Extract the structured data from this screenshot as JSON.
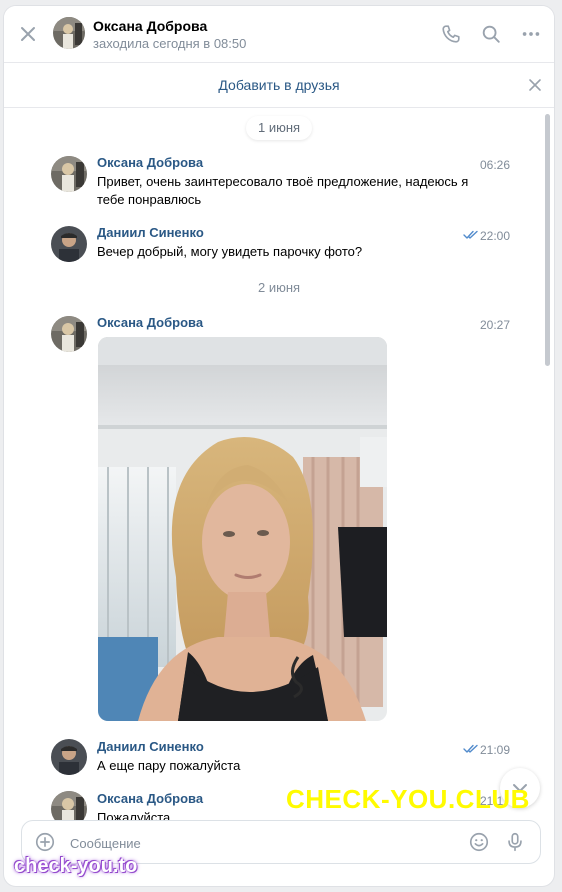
{
  "header": {
    "contact_name": "Оксана Доброва",
    "status": "заходила сегодня в 08:50",
    "icons": [
      "close-icon",
      "phone-icon",
      "search-icon",
      "more-icon"
    ]
  },
  "friend_bar": {
    "label": "Добавить в друзья"
  },
  "messages": [
    {
      "date": "1 июня"
    },
    {
      "author": "Оксана Доброва",
      "time": "06:26",
      "text": "Привет, очень заинтересовало твоё предложение, надеюсь я тебе понравлюсь"
    },
    {
      "author": "Даниил Синенко",
      "time": "22:00",
      "read": true,
      "text": "Вечер добрый, могу увидеть парочку фото?"
    },
    {
      "date": "2 июня"
    },
    {
      "author": "Оксана Доброва",
      "time": "20:27",
      "attachment": "photo"
    },
    {
      "author": "Даниил Синенко",
      "time": "21:09",
      "read": true,
      "text": "А еще пару пожалуйста"
    },
    {
      "author": "Оксана Доброва",
      "time": "21:1",
      "text": "Пожалуйста"
    }
  ],
  "composer": {
    "placeholder": "Сообщение",
    "value": ""
  },
  "watermarks": {
    "main": "CHECK-YOU.CLUB",
    "corner": "check-you.to"
  },
  "colors": {
    "accent": "#2a5885",
    "secondary_text": "#818c99",
    "read_check": "#528bcc",
    "watermark_main": "#fffb00",
    "watermark_corner": "#a25bd9"
  }
}
